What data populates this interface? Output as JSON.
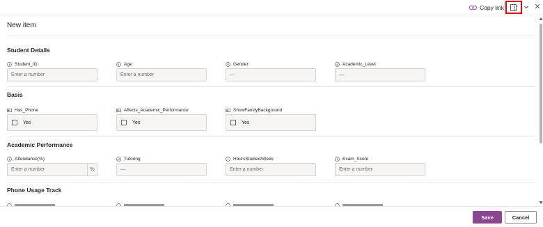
{
  "toolbar": {
    "copy_link_label": "Copy link",
    "close_glyph": "✕"
  },
  "form": {
    "title": "New item",
    "sections": {
      "student_details": {
        "title": "Student Details",
        "fields": [
          {
            "label": "Student_ID",
            "icon": "info-icon",
            "placeholder": "Enter a number"
          },
          {
            "label": "Age",
            "icon": "info-icon",
            "placeholder": "Enter a number"
          },
          {
            "label": "Gender",
            "icon": "choice-icon",
            "value": "—"
          },
          {
            "label": "Academic_Level",
            "icon": "choice-icon",
            "value": "—"
          }
        ]
      },
      "basis": {
        "title": "Basis",
        "fields": [
          {
            "label": "Has_Phone",
            "icon": "yesno-icon",
            "value": "Yes"
          },
          {
            "label": "Affects_Academic_Performance",
            "icon": "yesno-icon",
            "value": "Yes"
          },
          {
            "label": "ShowFamilyBackground",
            "icon": "yesno-icon",
            "value": "Yes"
          }
        ]
      },
      "academic_performance": {
        "title": "Academic Performance",
        "fields": [
          {
            "label": "Attendance(%)",
            "icon": "info-icon",
            "placeholder": "Enter a number",
            "unit": "%"
          },
          {
            "label": "Tutoring",
            "icon": "choice-icon",
            "value": "—"
          },
          {
            "label": "HoursStudied/Week",
            "icon": "info-icon",
            "placeholder": "Enter a number"
          },
          {
            "label": "Exam_Score",
            "icon": "info-icon",
            "placeholder": "Enter a number"
          }
        ]
      },
      "phone_usage": {
        "title": "Phone Usage Track"
      }
    }
  },
  "footer": {
    "save_label": "Save",
    "cancel_label": "Cancel"
  },
  "colors": {
    "accent": "#8b4593",
    "highlight": "#e10a0a",
    "field_bg": "#f6f5f4"
  }
}
